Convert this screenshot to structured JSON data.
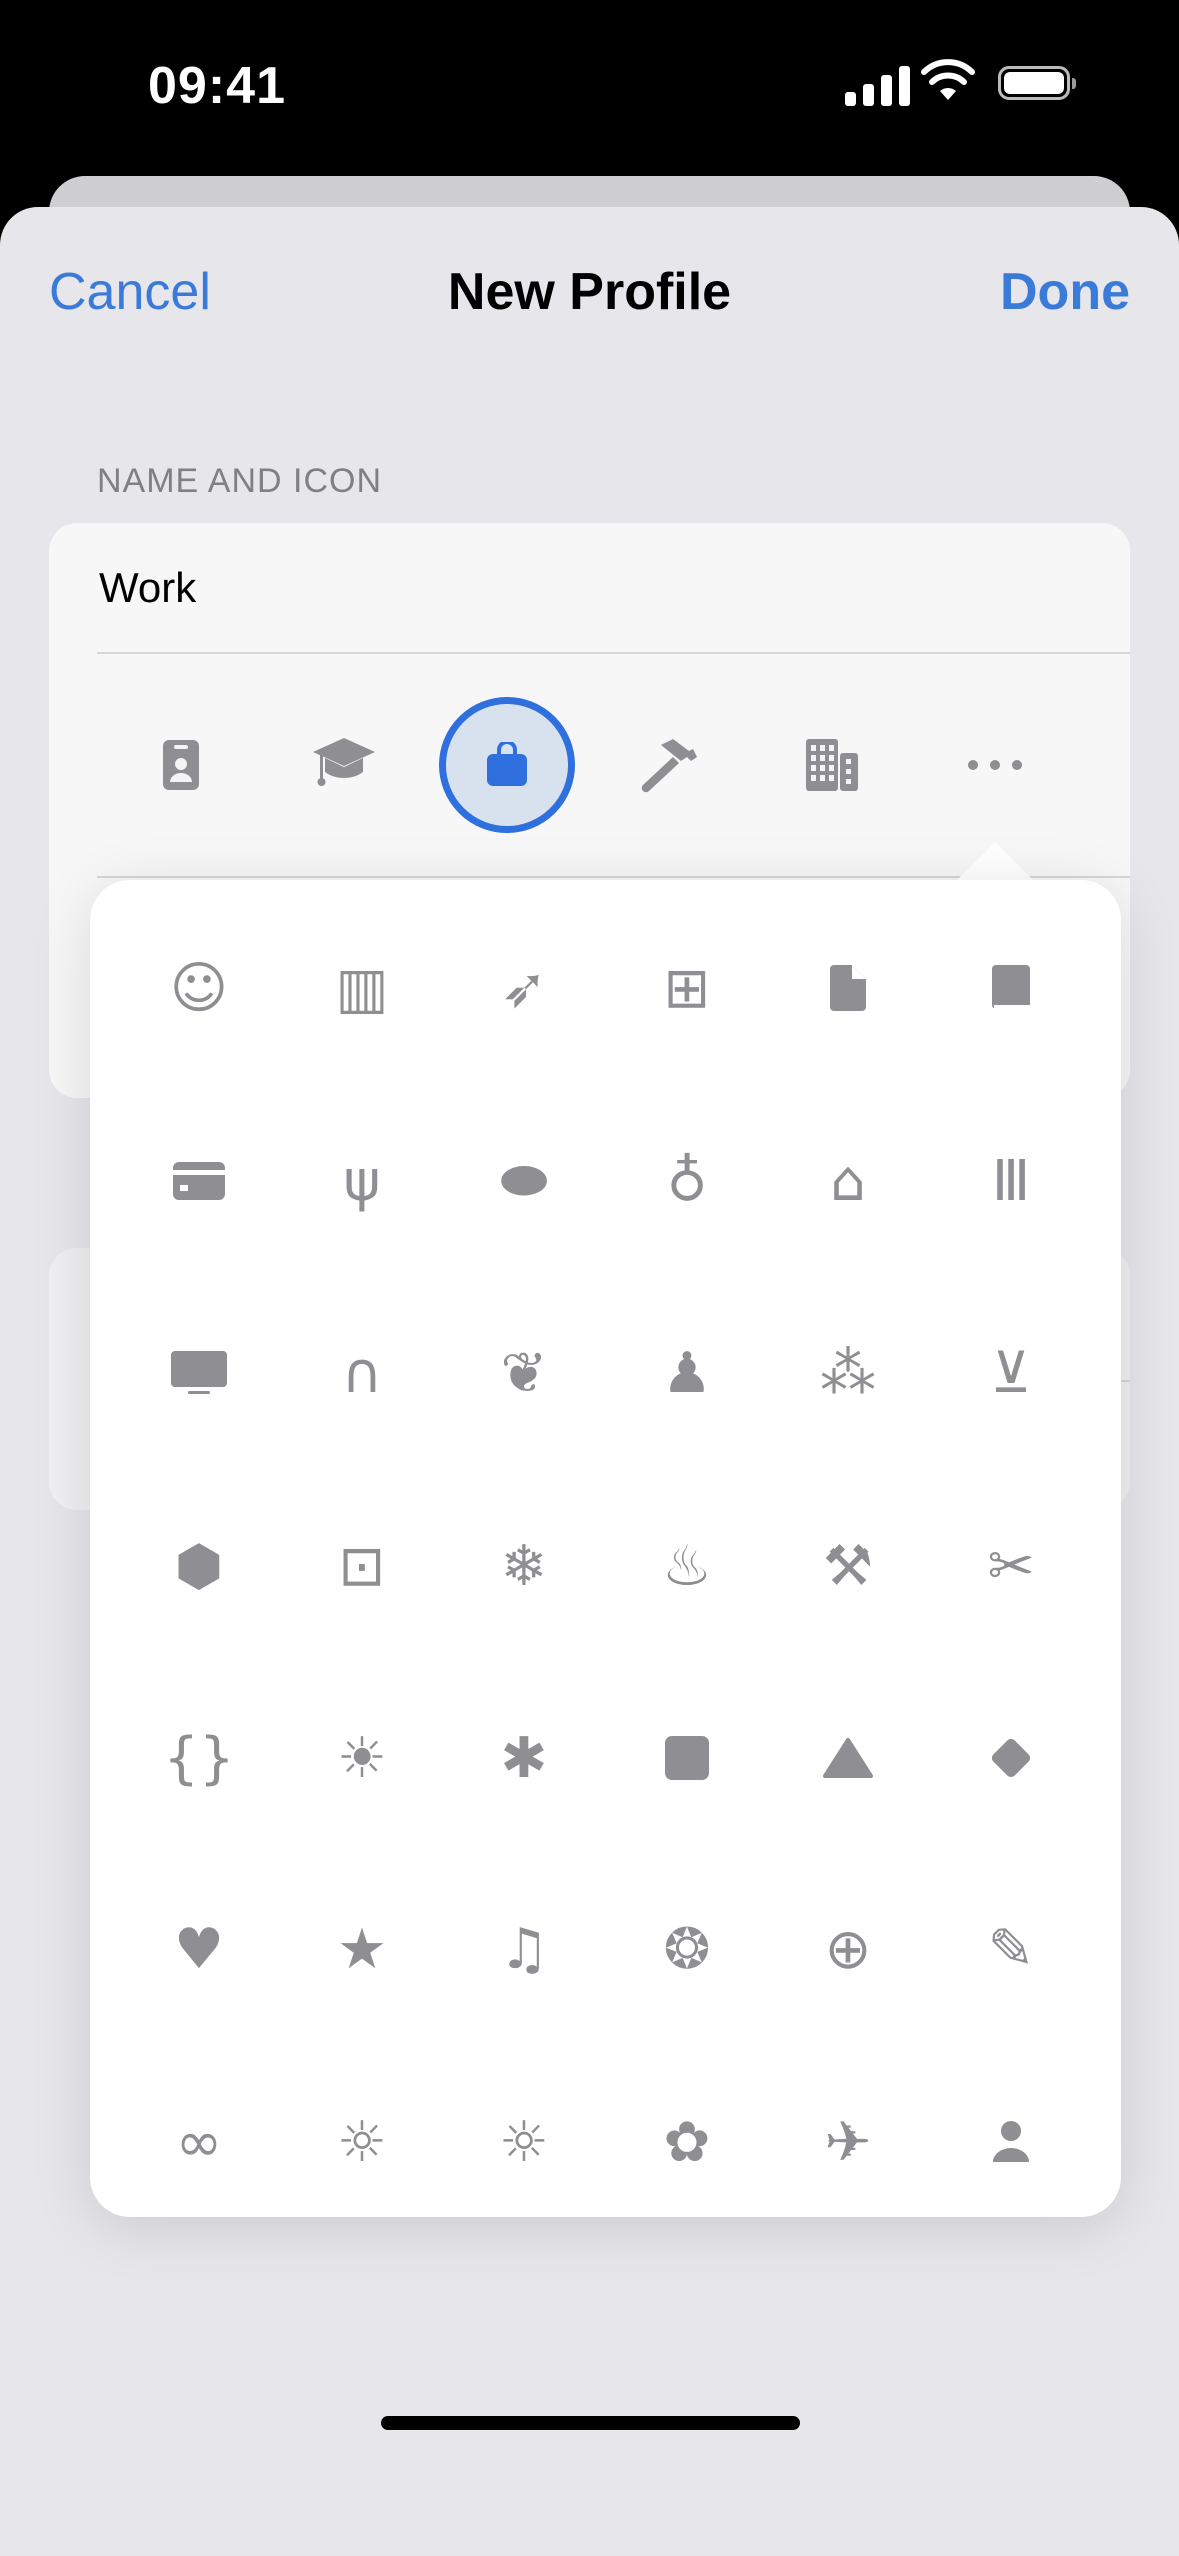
{
  "status_bar": {
    "time": "09:41"
  },
  "nav": {
    "cancel": "Cancel",
    "title": "New Profile",
    "done": "Done"
  },
  "section_header": "NAME AND ICON",
  "name_field": {
    "value": "Work"
  },
  "accent_color": "#2f6fde",
  "icon_color": "#8e8e93",
  "quick_icons": [
    {
      "icon": "person-badge-icon",
      "selected": false
    },
    {
      "icon": "graduation-cap-icon",
      "selected": false
    },
    {
      "icon": "briefcase-bag-icon",
      "selected": true
    },
    {
      "icon": "hammer-icon",
      "selected": false
    },
    {
      "icon": "building-icon",
      "selected": false
    },
    {
      "icon": "ellipsis-icon",
      "selected": false
    }
  ],
  "icon_grid": [
    [
      "smiley-face-icon",
      "books-icon",
      "rocket-icon",
      "gift-icon",
      "document-icon",
      "book-icon"
    ],
    [
      "credit-card-icon",
      "fork-knife-icon",
      "pills-icon",
      "stethoscope-icon",
      "house-icon",
      "bank-icon"
    ],
    [
      "tv-icon",
      "headphones-icon",
      "leaf-icon",
      "person-figure-icon",
      "pawprint-icon",
      "cart-icon"
    ],
    [
      "shipping-box-icon",
      "tram-icon",
      "snowflake-icon",
      "flame-icon",
      "tools-icon",
      "scissors-icon"
    ],
    [
      "curly-braces-icon",
      "lightbulb-icon",
      "asterisk-icon",
      "square-icon",
      "triangle-icon",
      "diamond-icon"
    ],
    [
      "heart-icon",
      "star-icon",
      "guitars-icon",
      "palette-icon",
      "globe-icon",
      "pencil-icon"
    ],
    [
      "bicycle-icon",
      "sunrise-icon",
      "sunset-icon",
      "flower-icon",
      "airplane-departure-icon",
      "person-icon"
    ]
  ]
}
